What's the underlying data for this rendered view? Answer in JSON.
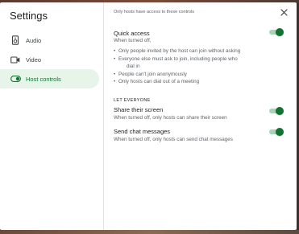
{
  "dialog": {
    "title": "Settings",
    "close_icon": "close-icon"
  },
  "sidebar": {
    "items": [
      {
        "label": "Audio",
        "icon": "speaker-icon",
        "active": false
      },
      {
        "label": "Video",
        "icon": "video-camera-icon",
        "active": false
      },
      {
        "label": "Host controls",
        "icon": "toggle-icon",
        "active": true
      }
    ]
  },
  "main": {
    "note": "Only hosts have access to these controls",
    "quick_access": {
      "title": "Quick access",
      "subtitle": "When turned off,",
      "bullets": [
        "Only people invited by the host can join without asking",
        "Everyone else must ask to join, including people who",
        "dial in",
        "People can't join anonymously",
        "Only hosts can dial out of a meeting"
      ],
      "enabled": true
    },
    "section_header": "LET EVERYONE",
    "share_screen": {
      "title": "Share their screen",
      "subtitle": "When turned off, only hosts can share their screen",
      "enabled": true
    },
    "send_chat": {
      "title": "Send chat messages",
      "subtitle": "When turned off, only hosts can send chat messages",
      "enabled": true
    }
  },
  "colors": {
    "accent": "#137333",
    "active_bg": "#e6f4ea",
    "track": "#a8d5b3"
  }
}
